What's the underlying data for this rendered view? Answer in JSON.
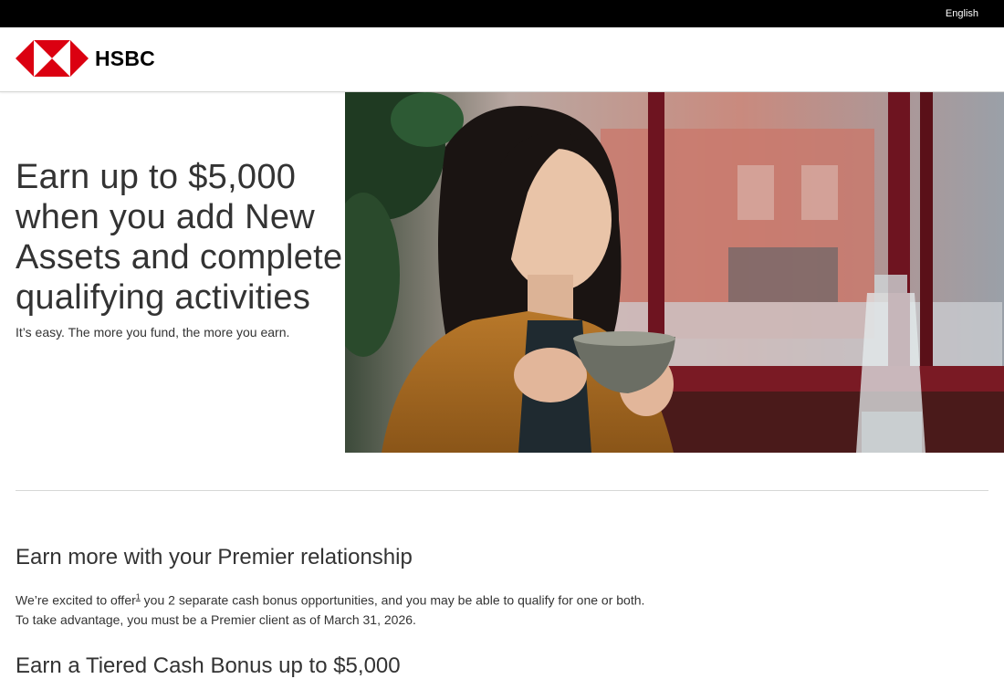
{
  "topbar": {
    "language_label": "English"
  },
  "header": {
    "logo_text": "HSBC",
    "brand_color": "#db0011"
  },
  "hero": {
    "title": "Earn up to $5,000 when you add New Assets and complete qualifying activities",
    "subtitle": "It’s easy. The more you fund, the more you earn.",
    "image": "woman-holding-coffee-cup-by-window"
  },
  "section": {
    "title": "Earn more with your Premier relationship",
    "body_before": "We’re excited to offer",
    "footnote": "1",
    "body_after": " you 2 separate cash bonus opportunities, and you may be able to qualify for one or both. To take advantage, you must be a Premier client as of March 31, 2026."
  },
  "section2": {
    "title": "Earn a Tiered Cash Bonus up to $5,000"
  }
}
